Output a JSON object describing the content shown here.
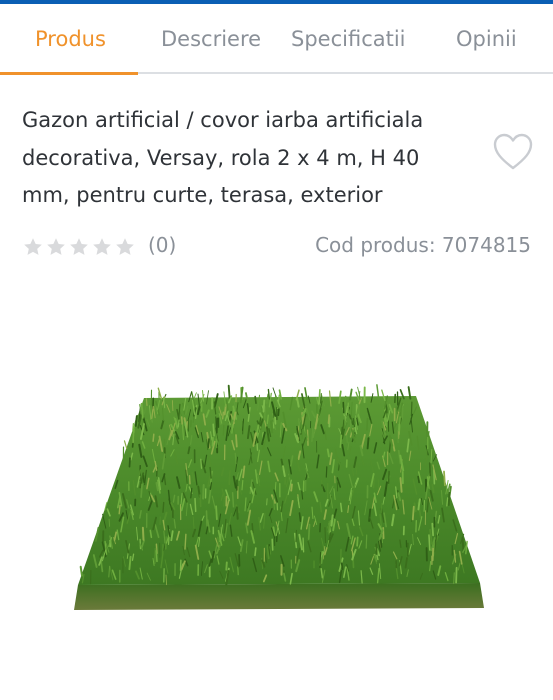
{
  "tabs": [
    {
      "label": "Produs",
      "active": true
    },
    {
      "label": "Descriere",
      "active": false
    },
    {
      "label": "Specificatii",
      "active": false
    },
    {
      "label": "Opinii",
      "active": false
    }
  ],
  "product": {
    "title": "Gazon artificial / covor iarba artificiala decorativa, Versay, rola 2 x 4 m, H 40 mm, pentru curte, terasa, exterior",
    "rating": 0,
    "rating_max": 5,
    "review_count": "(0)",
    "sku": "Cod produs: 7074815"
  },
  "icons": {
    "favorite": "heart-outline-icon",
    "rating": "star-icon"
  },
  "colors": {
    "accent": "#f0922b",
    "top_bar": "#0a5fb4",
    "muted_text": "#8a9098",
    "body_text": "#2f3338",
    "star_empty": "#d9dadc",
    "grass": "#3f7a22"
  }
}
